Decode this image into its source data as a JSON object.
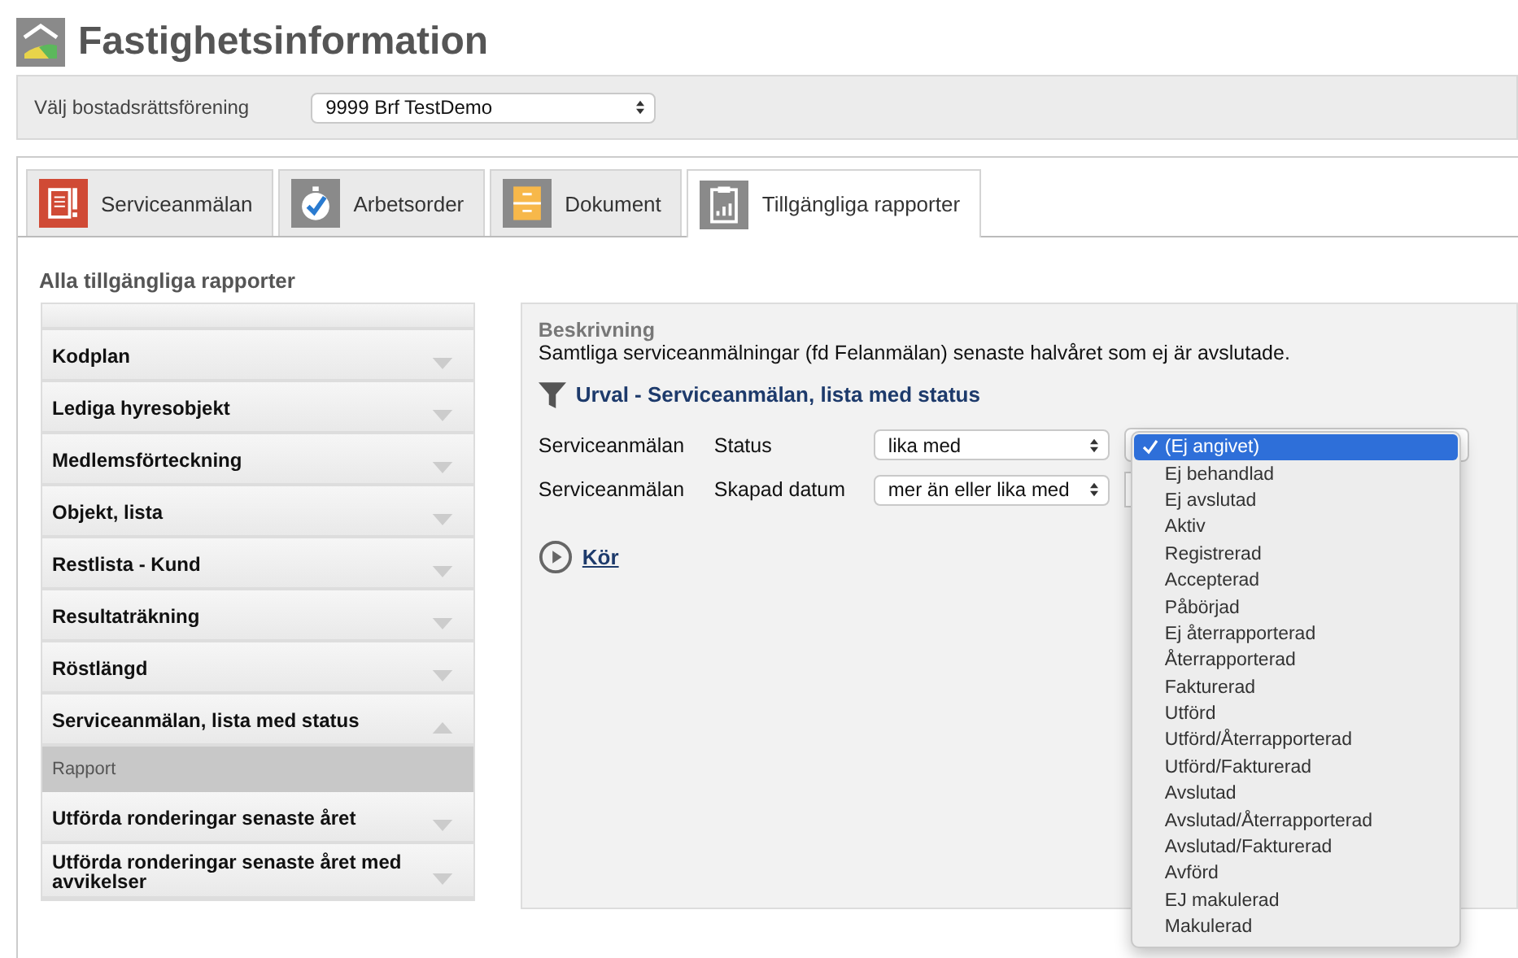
{
  "app": {
    "title": "Fastighetsinformation"
  },
  "association_picker": {
    "label": "Välj bostadsrättsförening",
    "value": "9999 Brf TestDemo"
  },
  "tabs": [
    {
      "label": "Serviceanmälan",
      "selected": false
    },
    {
      "label": "Arbetsorder",
      "selected": false
    },
    {
      "label": "Dokument",
      "selected": false
    },
    {
      "label": "Tillgängliga rapporter",
      "selected": true
    }
  ],
  "reports": {
    "heading": "Alla tillgängliga rapporter",
    "items": [
      {
        "label": "Kodplan",
        "expanded": false
      },
      {
        "label": "Lediga hyresobjekt",
        "expanded": false
      },
      {
        "label": "Medlemsförteckning",
        "expanded": false
      },
      {
        "label": "Objekt, lista",
        "expanded": false
      },
      {
        "label": "Restlista - Kund",
        "expanded": false
      },
      {
        "label": "Resultaträkning",
        "expanded": false
      },
      {
        "label": "Röstlängd",
        "expanded": false
      },
      {
        "label": "Serviceanmälan, lista med status",
        "expanded": true,
        "children": [
          {
            "label": "Rapport"
          }
        ]
      },
      {
        "label": "Utförda ronderingar senaste året",
        "expanded": false
      },
      {
        "label": "Utförda ronderingar senaste året med avvikelser",
        "expanded": false
      }
    ]
  },
  "detail": {
    "description_label": "Beskrivning",
    "description": "Samtliga serviceanmälningar (fd Felanmälan) senaste halvåret som ej är avslutade.",
    "filter_title": "Urval - Serviceanmälan, lista med status",
    "criteria": [
      {
        "entity": "Serviceanmälan",
        "field": "Status",
        "operator": "lika med",
        "kind": "select"
      },
      {
        "entity": "Serviceanmälan",
        "field": "Skapad datum",
        "operator": "mer än eller lika med",
        "kind": "input"
      }
    ],
    "run_link": "Kör"
  },
  "status_menu": {
    "options": [
      {
        "label": "(Ej angivet)",
        "selected": true
      },
      {
        "label": "Ej behandlad",
        "selected": false
      },
      {
        "label": "Ej avslutad",
        "selected": false
      },
      {
        "label": "Aktiv",
        "selected": false
      },
      {
        "label": "Registrerad",
        "selected": false
      },
      {
        "label": "Accepterad",
        "selected": false
      },
      {
        "label": "Påbörjad",
        "selected": false
      },
      {
        "label": "Ej återrapporterad",
        "selected": false
      },
      {
        "label": "Återrapporterad",
        "selected": false
      },
      {
        "label": "Fakturerad",
        "selected": false
      },
      {
        "label": "Utförd",
        "selected": false
      },
      {
        "label": "Utförd/Återrapporterad",
        "selected": false
      },
      {
        "label": "Utförd/Fakturerad",
        "selected": false
      },
      {
        "label": "Avslutad",
        "selected": false
      },
      {
        "label": "Avslutad/Återrapporterad",
        "selected": false
      },
      {
        "label": "Avslutad/Fakturerad",
        "selected": false
      },
      {
        "label": "Avförd",
        "selected": false
      },
      {
        "label": "EJ makulerad",
        "selected": false
      },
      {
        "label": "Makulerad",
        "selected": false
      }
    ]
  }
}
